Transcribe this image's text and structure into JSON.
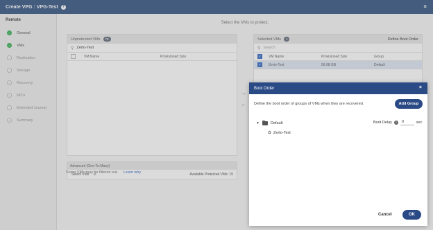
{
  "window": {
    "title": "Create VPG : VPG-Test",
    "help_glyph": "?",
    "close_glyph": "×"
  },
  "sidebar": {
    "section": "Remote",
    "steps": [
      {
        "label": "General",
        "status": "done",
        "glyph": "✓"
      },
      {
        "label": "VMs",
        "status": "done",
        "glyph": "✓"
      },
      {
        "label": "Replication",
        "status": "todo",
        "glyph": "3"
      },
      {
        "label": "Storage",
        "status": "todo",
        "glyph": "4"
      },
      {
        "label": "Recovery",
        "status": "todo",
        "glyph": "5"
      },
      {
        "label": "NICs",
        "status": "todo",
        "glyph": "6"
      },
      {
        "label": "Extended Journal",
        "status": "todo",
        "glyph": "7"
      },
      {
        "label": "Summary",
        "status": "todo",
        "glyph": "8"
      }
    ]
  },
  "main": {
    "instruction": "Select the VMs to protect.",
    "unprotected": {
      "title": "Unprotected VMs",
      "count": "78",
      "search_value": "Zerto-Test",
      "col_name": "VM Name",
      "col_size": "Provisioned Size"
    },
    "advanced": {
      "title": "Advanced (One-To-Many)",
      "select_vms": "Select VMs",
      "select_vms_glyph": "⚙",
      "available": "Available Protected VMs: 15"
    },
    "filter_note": "Some VMs may be filtered out.",
    "learn_why": "Learn why",
    "move_right_glyph": "→",
    "move_left_glyph": "←",
    "selected": {
      "title": "Selected VMs",
      "count": "1",
      "define_boot": "Define Boot Order",
      "search_placeholder": "Search",
      "col_name": "VM Name",
      "col_size": "Provisioned Size",
      "col_group": "Group",
      "rows": [
        {
          "name": "Zerto-Test",
          "size": "56.08 GB",
          "group": "Default"
        }
      ]
    }
  },
  "dialog": {
    "title": "Boot Order",
    "close_glyph": "×",
    "description": "Define the boot order of groups of VMs when they are recovered.",
    "add_group": "Add Group",
    "group_name": "Default",
    "boot_delay_label": "Boot Delay",
    "boot_delay_value": "0",
    "boot_delay_unit": "sec",
    "vm_name": "Zerto-Test",
    "cancel": "Cancel",
    "ok": "OK"
  },
  "colors": {
    "accent": "#2a4a86",
    "titlebar": "#3e5e8a",
    "done": "#3eb35a"
  }
}
